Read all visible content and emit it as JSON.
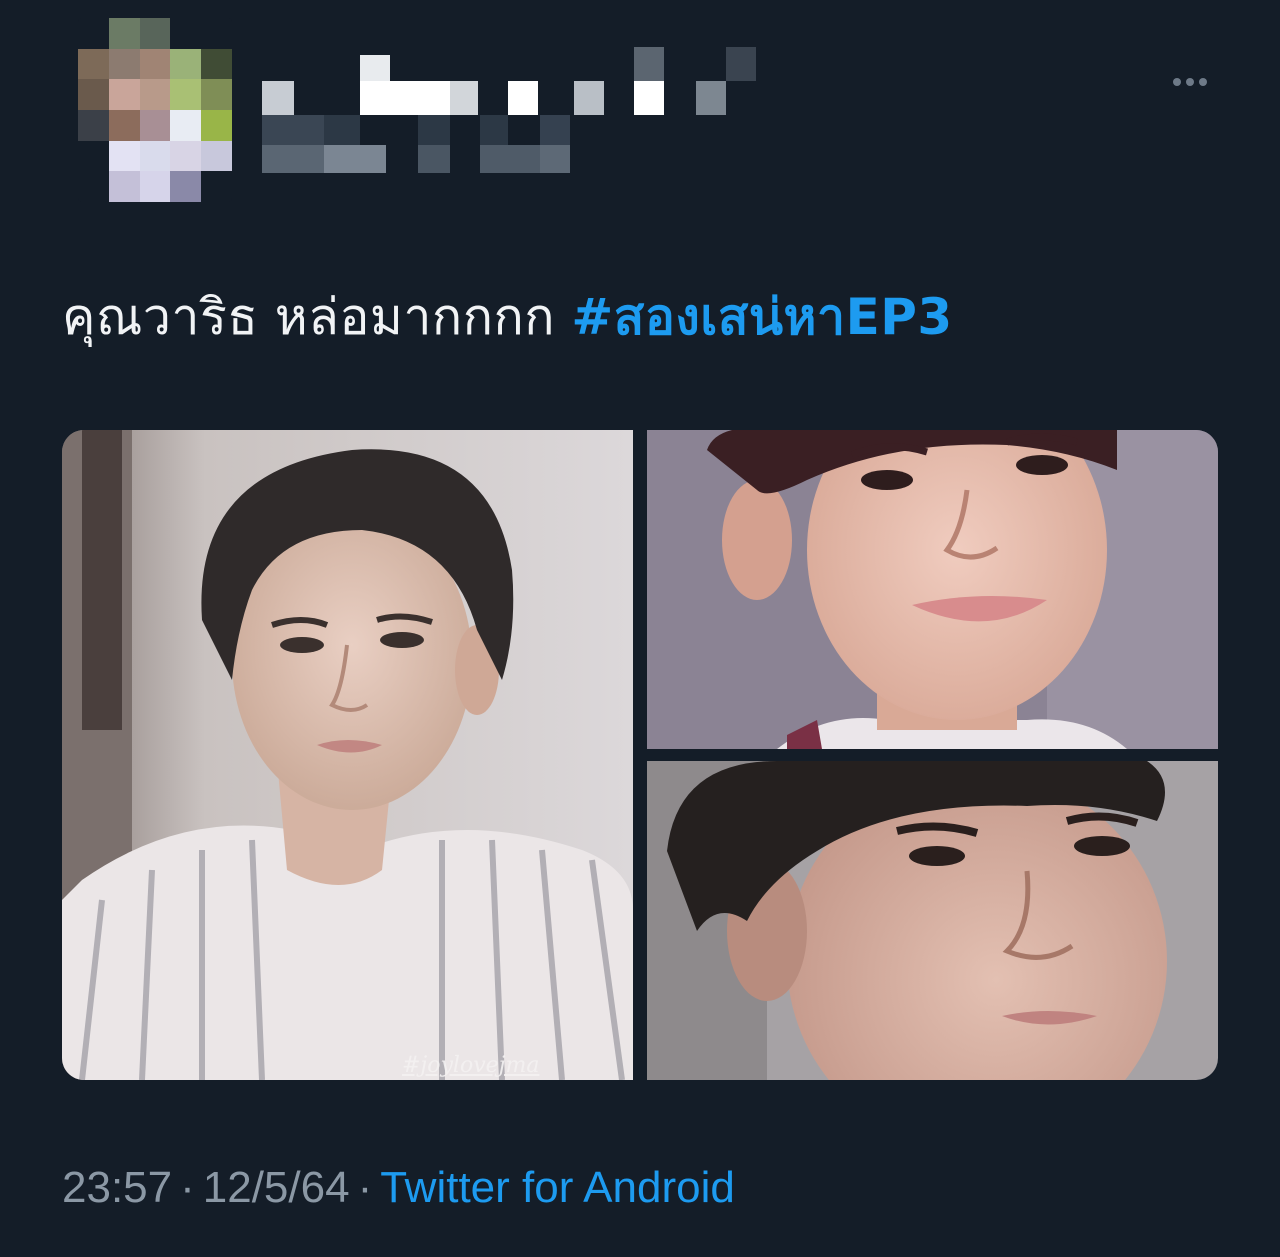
{
  "tweet": {
    "text": "คุณวาริธ หล่อมากกกก ",
    "hashtag": "#สองเสน่หาEP3",
    "time": "23:57",
    "separator": "·",
    "date": "12/5/64",
    "source": "Twitter for Android"
  },
  "media": {
    "watermark": "#joylovejma"
  },
  "colors": {
    "background": "#141d28",
    "link": "#1d9bf0",
    "meta": "#8b98a5"
  },
  "icons": {
    "more": "more-horizontal-icon"
  }
}
